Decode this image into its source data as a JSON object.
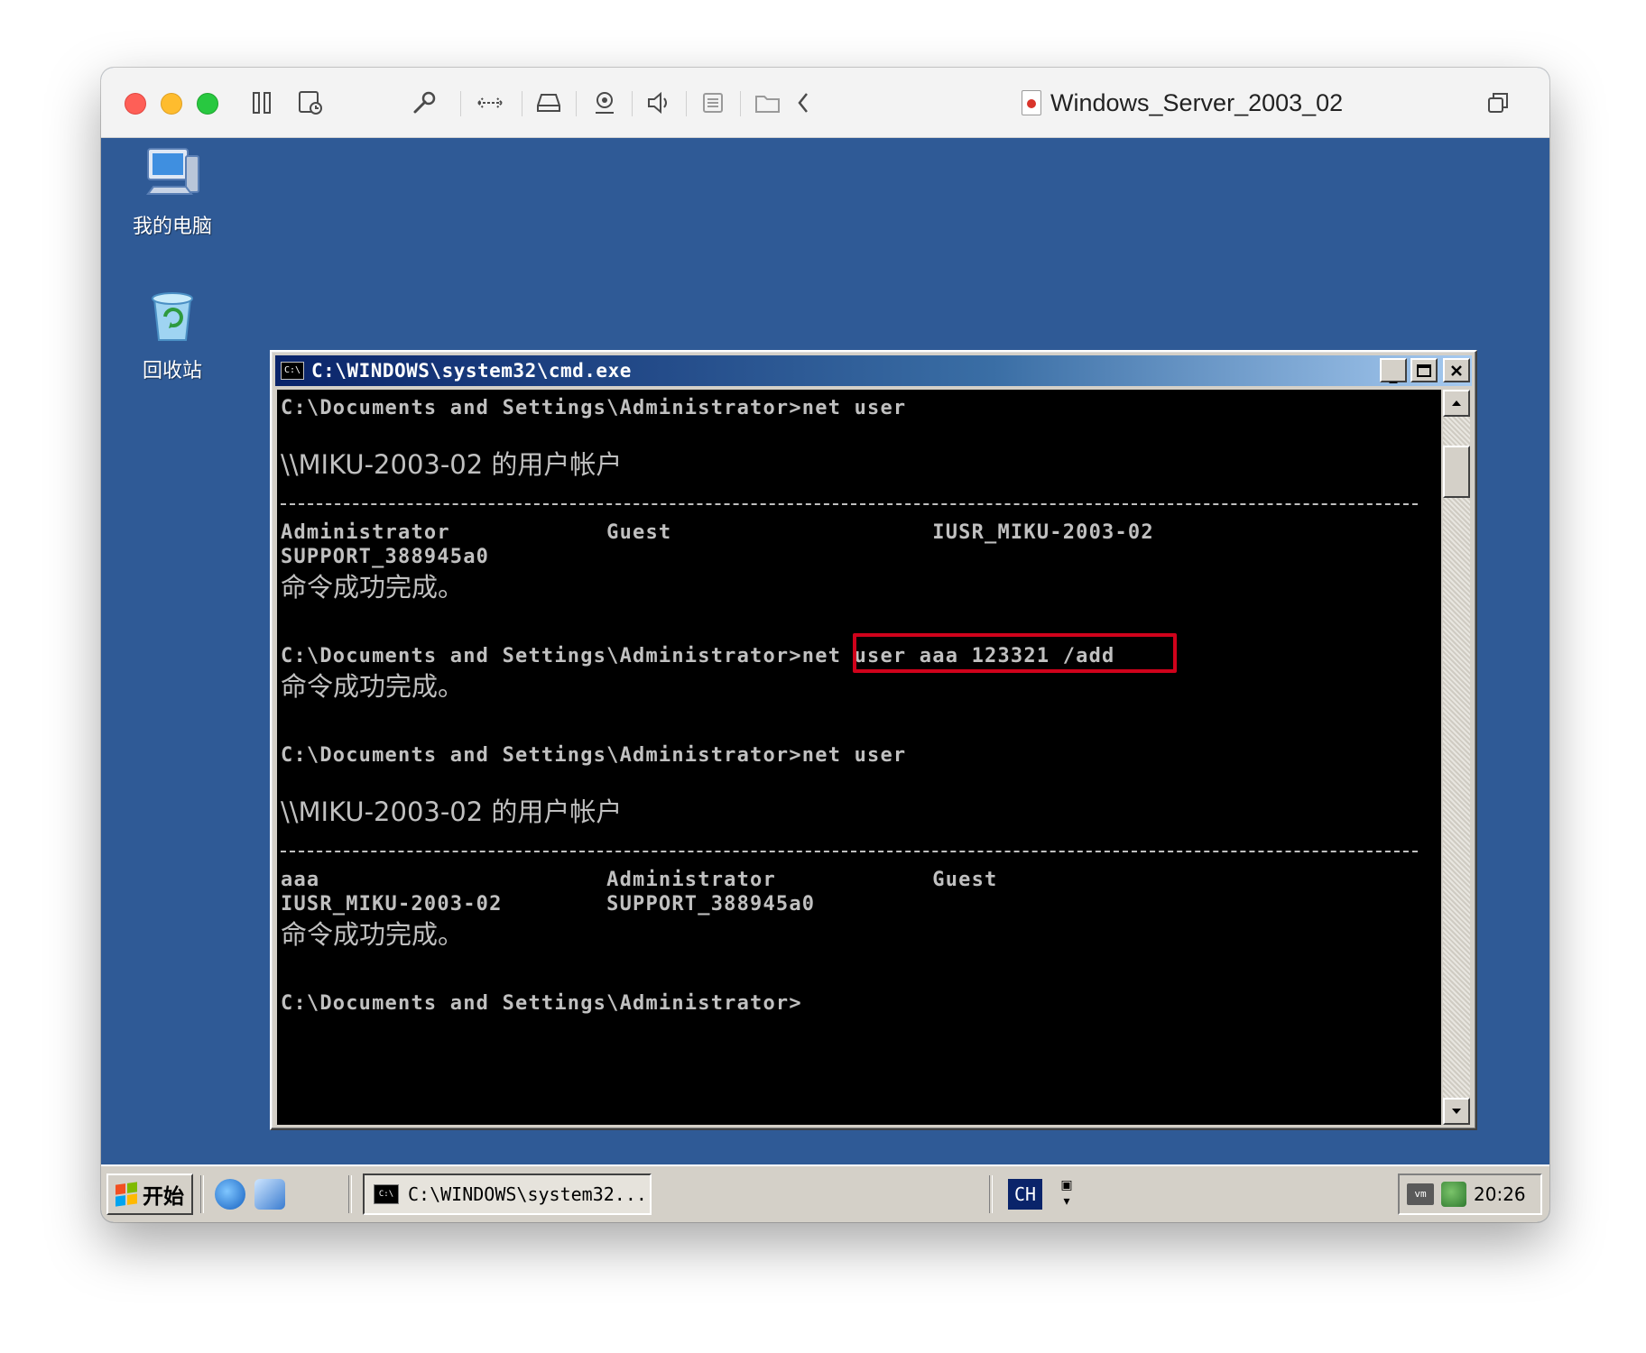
{
  "vm_window": {
    "title": "Windows_Server_2003_02"
  },
  "desktop": {
    "icons": [
      {
        "label": "我的电脑",
        "icon": "my-computer-icon"
      },
      {
        "label": "回收站",
        "icon": "recycle-bin-icon"
      }
    ]
  },
  "cmd": {
    "title": "C:\\WINDOWS\\system32\\cmd.exe",
    "lines": [
      "C:\\Documents and Settings\\Administrator>net user",
      "\\\\MIKU-2003-02 的用户帐户",
      "Administrator            Guest                    IUSR_MIKU-2003-02",
      "SUPPORT_388945a0",
      "命令成功完成。",
      "C:\\Documents and Settings\\Administrator>net user aaa 123321 /add",
      "命令成功完成。",
      "C:\\Documents and Settings\\Administrator>net user",
      "\\\\MIKU-2003-02 的用户帐户",
      "aaa                      Administrator            Guest",
      "IUSR_MIKU-2003-02        SUPPORT_388945a0",
      "命令成功完成。",
      "C:\\Documents and Settings\\Administrator>"
    ],
    "highlighted_command": "net user aaa 123321 /add",
    "highlight_color": "#d0021b"
  },
  "taskbar": {
    "start_label": "开始",
    "task_label": "C:\\WINDOWS\\system32...",
    "ime_label": "CH",
    "clock": "20:26"
  }
}
